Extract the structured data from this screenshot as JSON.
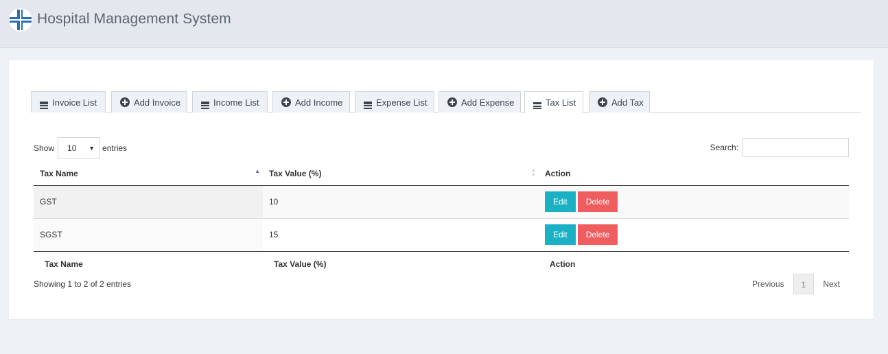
{
  "header": {
    "title": "Hospital Management System",
    "logo_icon": "medical-cross-icon",
    "colors": {
      "logo_blue": "#2a6fb6",
      "bar_bg": "#e4e8ee"
    }
  },
  "tabs": [
    {
      "label": "Invoice List",
      "icon": "list-icon",
      "active": false
    },
    {
      "label": "Add Invoice",
      "icon": "plus-circle-icon",
      "active": false
    },
    {
      "label": "Income List",
      "icon": "list-icon",
      "active": false
    },
    {
      "label": "Add Income",
      "icon": "plus-circle-icon",
      "active": false
    },
    {
      "label": "Expense List",
      "icon": "list-icon",
      "active": false
    },
    {
      "label": "Add Expense",
      "icon": "plus-circle-icon",
      "active": false
    },
    {
      "label": "Tax List",
      "icon": "list-icon",
      "active": true
    },
    {
      "label": "Add Tax",
      "icon": "plus-circle-icon",
      "active": false
    }
  ],
  "length": {
    "show_label": "Show",
    "value": "10",
    "entries_label": "entries"
  },
  "search": {
    "label": "Search:",
    "value": ""
  },
  "table": {
    "columns": [
      "Tax Name",
      "Tax Value (%)",
      "Action"
    ],
    "sort_column": "Tax Name",
    "rows": [
      {
        "name": "GST",
        "value": "10"
      },
      {
        "name": "SGST",
        "value": "15"
      }
    ],
    "edit_label": "Edit",
    "delete_label": "Delete",
    "footer": [
      "Tax Name",
      "Tax Value (%)",
      "Action"
    ]
  },
  "info": "Showing 1 to 2 of 2 entries",
  "pagination": {
    "previous": "Previous",
    "current": "1",
    "next": "Next"
  },
  "colors": {
    "edit": "#1ab1c4",
    "delete": "#ef5d5f"
  }
}
